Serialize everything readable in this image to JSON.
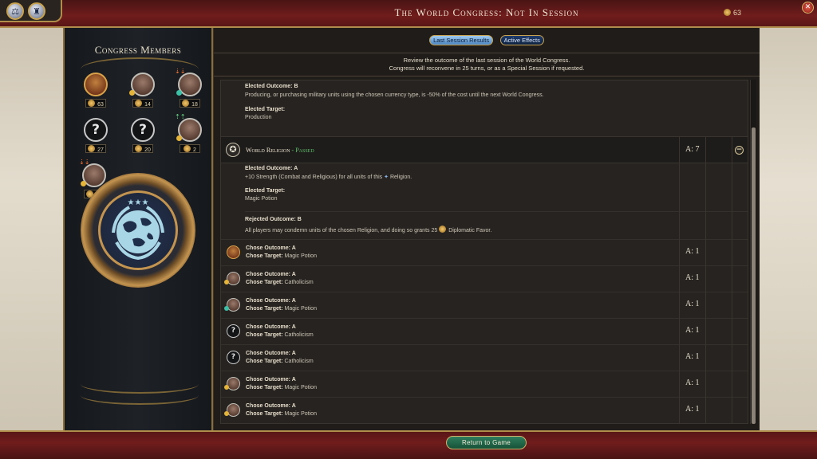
{
  "header": {
    "title": "The World Congress: Not In Session",
    "favor": "63"
  },
  "sidebar": {
    "title": "Congress Members",
    "members": [
      {
        "favor": "63",
        "kind": "me"
      },
      {
        "favor": "14",
        "kind": "leader"
      },
      {
        "favor": "18",
        "kind": "leader",
        "arrows": "⇣⇣"
      },
      {
        "favor": "27",
        "kind": "unknown",
        "glyph": "?"
      },
      {
        "favor": "20",
        "kind": "unknown",
        "glyph": "?"
      },
      {
        "favor": "2",
        "kind": "leader",
        "arrows": "⇡⇡"
      },
      {
        "favor": "13",
        "kind": "leader",
        "arrows": "⇣⇣"
      }
    ]
  },
  "tabs": {
    "last_session": "Last Session Results",
    "active_effects": "Active Effects"
  },
  "intro": {
    "line1": "Review the outcome of the last session of the World Congress.",
    "line2": "Congress will reconvene in 25 turns, or as a Special Session if requested."
  },
  "previous_resolution": {
    "elected_outcome_label": "Elected Outcome: B",
    "elected_outcome_text": "Producing, or purchasing military units using the chosen currency type, is -50% of the cost until the next World Congress.",
    "elected_target_label": "Elected Target:",
    "elected_target_value": "Production"
  },
  "resolution": {
    "icon": "✪",
    "name": "World Religion",
    "status": " - Passed",
    "votes": "A: 7",
    "collapse_glyph": "−",
    "elected_outcome_label": "Elected Outcome: A",
    "elected_outcome_text": "+10 Strength (Combat and Religious) for all units of this",
    "elected_outcome_text2": "Religion.",
    "elected_target_label": "Elected Target:",
    "elected_target_value": "Magic Potion",
    "rejected_outcome_label": "Rejected Outcome: B",
    "rejected_outcome_text": "All players may condemn units of the chosen Religion, and doing so grants 25",
    "rejected_outcome_text2": "Diplomatic Favor."
  },
  "votes": [
    {
      "outcome": "Chose Outcome: A",
      "target_label": "Chose Target:",
      "target": "Magic Potion",
      "vote": "A: 1",
      "kind": "me"
    },
    {
      "outcome": "Chose Outcome: A",
      "target_label": "Chose Target:",
      "target": "Catholicism",
      "vote": "A: 1",
      "kind": "leader"
    },
    {
      "outcome": "Chose Outcome: A",
      "target_label": "Chose Target:",
      "target": "Magic Potion",
      "vote": "A: 1",
      "kind": "leader-teal"
    },
    {
      "outcome": "Chose Outcome: A",
      "target_label": "Chose Target:",
      "target": "Catholicism",
      "vote": "A: 1",
      "kind": "unknown",
      "glyph": "?"
    },
    {
      "outcome": "Chose Outcome: A",
      "target_label": "Chose Target:",
      "target": "Catholicism",
      "vote": "A: 1",
      "kind": "unknown",
      "glyph": "?"
    },
    {
      "outcome": "Chose Outcome: A",
      "target_label": "Chose Target:",
      "target": "Magic Potion",
      "vote": "A: 1",
      "kind": "leader"
    },
    {
      "outcome": "Chose Outcome: A",
      "target_label": "Chose Target:",
      "target": "Magic Potion",
      "vote": "A: 1",
      "kind": "leader"
    }
  ],
  "footer": {
    "return_label": "Return to Game"
  }
}
